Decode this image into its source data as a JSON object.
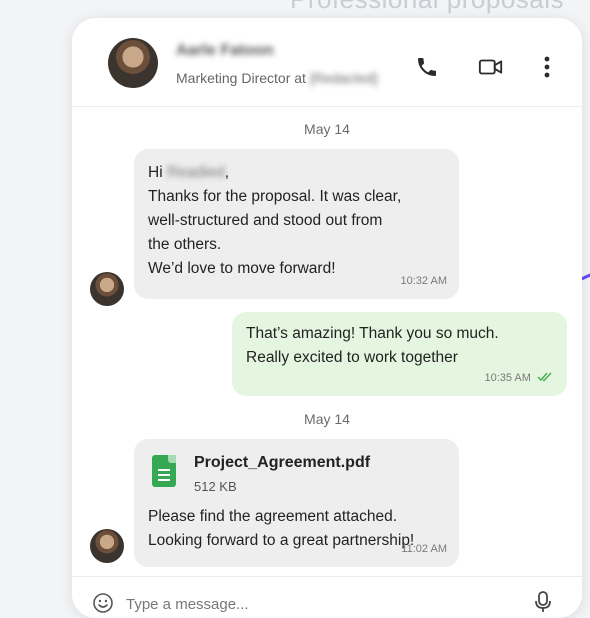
{
  "background": {
    "heading": "Professional proposals"
  },
  "header": {
    "contact_name": "Aarle Fatoon",
    "role_prefix": "Marketing Director at",
    "role_company": "[Redacted]",
    "icons": [
      "phone-icon",
      "video-call-icon",
      "more-vertical-icon"
    ]
  },
  "messages": [
    {
      "type": "date",
      "label": "May 14"
    },
    {
      "type": "incoming",
      "greeting_prefix": "Hi ",
      "greeting_name": "Readied",
      "greeting_suffix": ",",
      "lines": [
        "Thanks for the proposal. It was clear,",
        "well-structured and stood out from",
        "the others.",
        "We’d love to move forward!"
      ],
      "time": "10:32 AM"
    },
    {
      "type": "outgoing",
      "lines": [
        "That’s amazing! Thank you so much.",
        "Really excited to work together"
      ],
      "time": "10:35 AM",
      "status": "read"
    },
    {
      "type": "date",
      "label": "May 14"
    },
    {
      "type": "incoming-file",
      "file_name": "Project_Agreement.pdf",
      "file_size": "512 KB",
      "lines": [
        "Please find the agreement attached.",
        "Looking forward to a great partnership!"
      ],
      "time": "11:02 AM"
    }
  ],
  "composer": {
    "placeholder": "Type a message..."
  },
  "colors": {
    "incoming_bubble": "#eeeeee",
    "outgoing_bubble": "#e4f6df",
    "file_icon": "#34a853",
    "read_check": "#4caf50",
    "accent_arc": "#6a4cf0"
  }
}
